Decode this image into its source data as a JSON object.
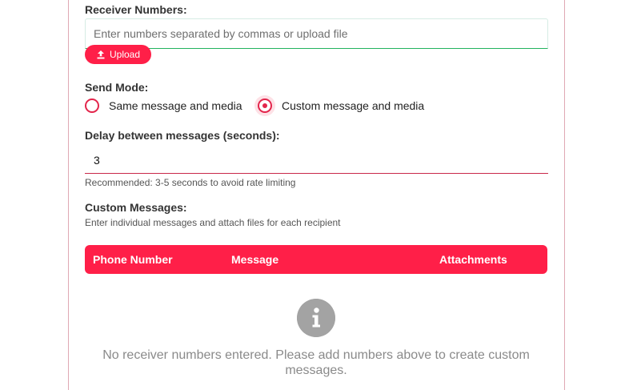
{
  "receivers": {
    "label": "Receiver Numbers:",
    "value": "",
    "placeholder": "Enter numbers separated by commas or upload file",
    "upload_label": "Upload",
    "upload_icon": "upload-icon"
  },
  "send_mode": {
    "label": "Send Mode:",
    "options": [
      {
        "label": "Same message and media",
        "selected": false
      },
      {
        "label": "Custom message and media",
        "selected": true
      }
    ]
  },
  "delay": {
    "label": "Delay between messages (seconds):",
    "value": "3",
    "hint": "Recommended: 3-5 seconds to avoid rate limiting"
  },
  "custom_messages": {
    "label": "Custom Messages:",
    "hint": "Enter individual messages and attach files for each recipient",
    "columns": [
      "Phone Number",
      "Message",
      "Attachments"
    ],
    "empty_icon": "info-icon",
    "empty_text": "No receiver numbers entered. Please add numbers above to create custom messages."
  },
  "colors": {
    "accent": "#ff1f48",
    "radio": "#e3254b",
    "valid_underline": "#22b35e",
    "muted_text": "#8a8a8a",
    "info_icon": "#a3a3a3"
  }
}
